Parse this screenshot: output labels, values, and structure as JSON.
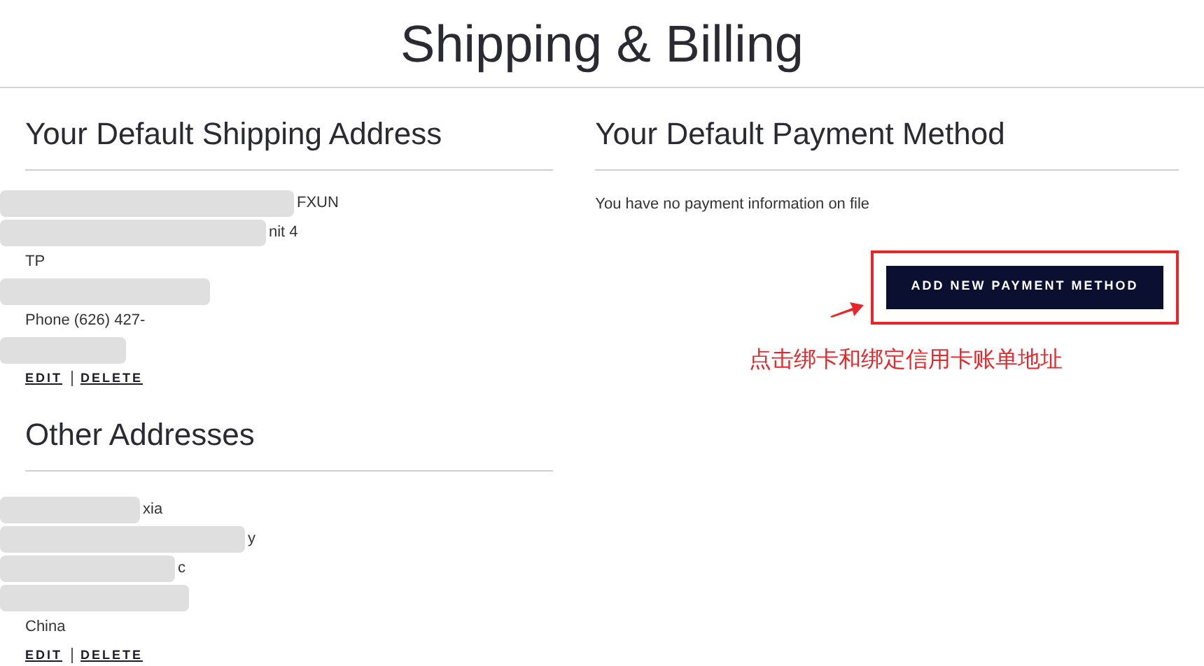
{
  "title": "Shipping & Billing",
  "default_shipping": {
    "heading": "Your Default Shipping Address",
    "lines": [
      {
        "kind": "blur",
        "text": "FXUN"
      },
      {
        "kind": "blur",
        "text": "nit 4"
      },
      {
        "kind": "text",
        "text": "TP"
      },
      {
        "kind": "blur"
      },
      {
        "kind": "text",
        "text": "Phone (626) 427-"
      },
      {
        "kind": "blur"
      }
    ],
    "links": [
      "EDIT",
      "DELETE"
    ]
  },
  "other_addresses": {
    "heading": "Other Addresses",
    "lines": [
      {
        "kind": "blur",
        "text": "xia"
      },
      {
        "kind": "blur",
        "text": "y"
      },
      {
        "kind": "blur",
        "text": "c"
      },
      {
        "kind": "blur"
      },
      {
        "kind": "text",
        "text": "China"
      }
    ],
    "links": [
      "EDIT",
      "DELETE"
    ]
  },
  "payment": {
    "heading": "Your Default Payment Method",
    "message": "You have no payment information on file",
    "button": "ADD NEW PAYMENT METHOD"
  },
  "annotation": {
    "note": "点击绑卡和绑定信用卡账单地址"
  }
}
